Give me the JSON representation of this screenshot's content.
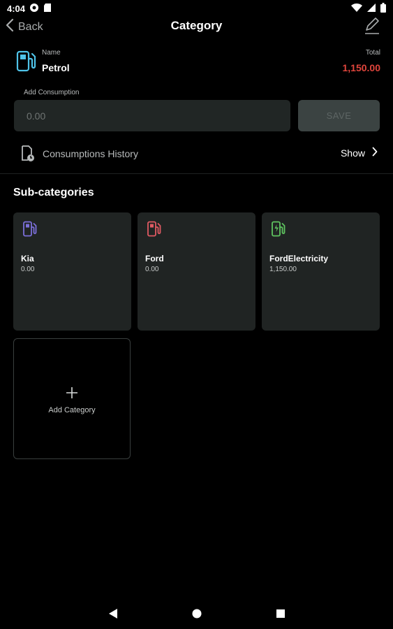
{
  "status_bar": {
    "time": "4:04"
  },
  "app_bar": {
    "back_label": "Back",
    "title": "Category"
  },
  "category": {
    "name_label": "Name",
    "name": "Petrol",
    "total_label": "Total",
    "total": "1,150.00",
    "icon": "fuel-pump-icon",
    "icon_color": "#4fc3e8"
  },
  "consumption": {
    "label": "Add Consumption",
    "placeholder": "0.00",
    "save_label": "SAVE"
  },
  "history": {
    "label": "Consumptions History",
    "show_label": "Show"
  },
  "subcategories": {
    "title": "Sub-categories",
    "items": [
      {
        "name": "Kia",
        "value": "0.00",
        "icon": "fuel-pump-icon",
        "color": "#7b6fd9"
      },
      {
        "name": "Ford",
        "value": "0.00",
        "icon": "fuel-pump-icon",
        "color": "#e05a63"
      },
      {
        "name": "FordElectricity",
        "value": "1,150.00",
        "icon": "ev-charger-icon",
        "color": "#5fc460"
      }
    ],
    "add_label": "Add Category"
  },
  "colors": {
    "accent_total": "#e0453c",
    "background": "#000000",
    "tile": "#202423"
  }
}
